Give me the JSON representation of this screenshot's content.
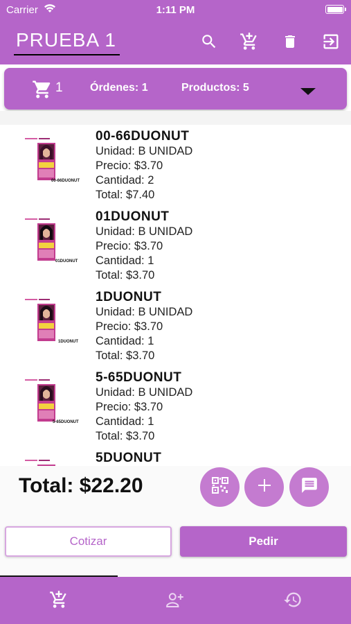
{
  "status_bar": {
    "carrier": "Carrier",
    "time": "1:11 PM"
  },
  "header": {
    "title": "PRUEBA 1",
    "icons": [
      "search-icon",
      "add-to-cart-icon",
      "delete-icon",
      "logout-icon"
    ]
  },
  "summary": {
    "cart_count": "1",
    "ordenes": "Órdenes: 1",
    "productos": "Productos: 5"
  },
  "products": [
    {
      "code": "00-66DUONUT",
      "unidad": "Unidad: B UNIDAD",
      "precio": "Precio: $3.70",
      "cantidad": "Cantidad: 2",
      "total": "Total: $7.40",
      "thumb_label": "00-66DUONUT"
    },
    {
      "code": "01DUONUT",
      "unidad": "Unidad: B UNIDAD",
      "precio": "Precio: $3.70",
      "cantidad": "Cantidad: 1",
      "total": "Total: $3.70",
      "thumb_label": "01DUONUT"
    },
    {
      "code": "1DUONUT",
      "unidad": "Unidad: B UNIDAD",
      "precio": "Precio: $3.70",
      "cantidad": "Cantidad: 1",
      "total": "Total: $3.70",
      "thumb_label": "1DUONUT"
    },
    {
      "code": "5-65DUONUT",
      "unidad": "Unidad: B UNIDAD",
      "precio": "Precio: $3.70",
      "cantidad": "Cantidad: 1",
      "total": "Total: $3.70",
      "thumb_label": "5-65DUONUT"
    },
    {
      "code": "5DUONUT",
      "unidad": "",
      "precio": "",
      "cantidad": "",
      "total": "",
      "thumb_label": ""
    }
  ],
  "footer": {
    "total": "Total: $22.20",
    "cotizar_label": "Cotizar",
    "pedir_label": "Pedir"
  },
  "tabs": [
    "cart-icon",
    "add-person-icon",
    "history-icon"
  ],
  "colors": {
    "primary": "#b565c9",
    "fab": "#c47bd0",
    "text": "#111111"
  }
}
